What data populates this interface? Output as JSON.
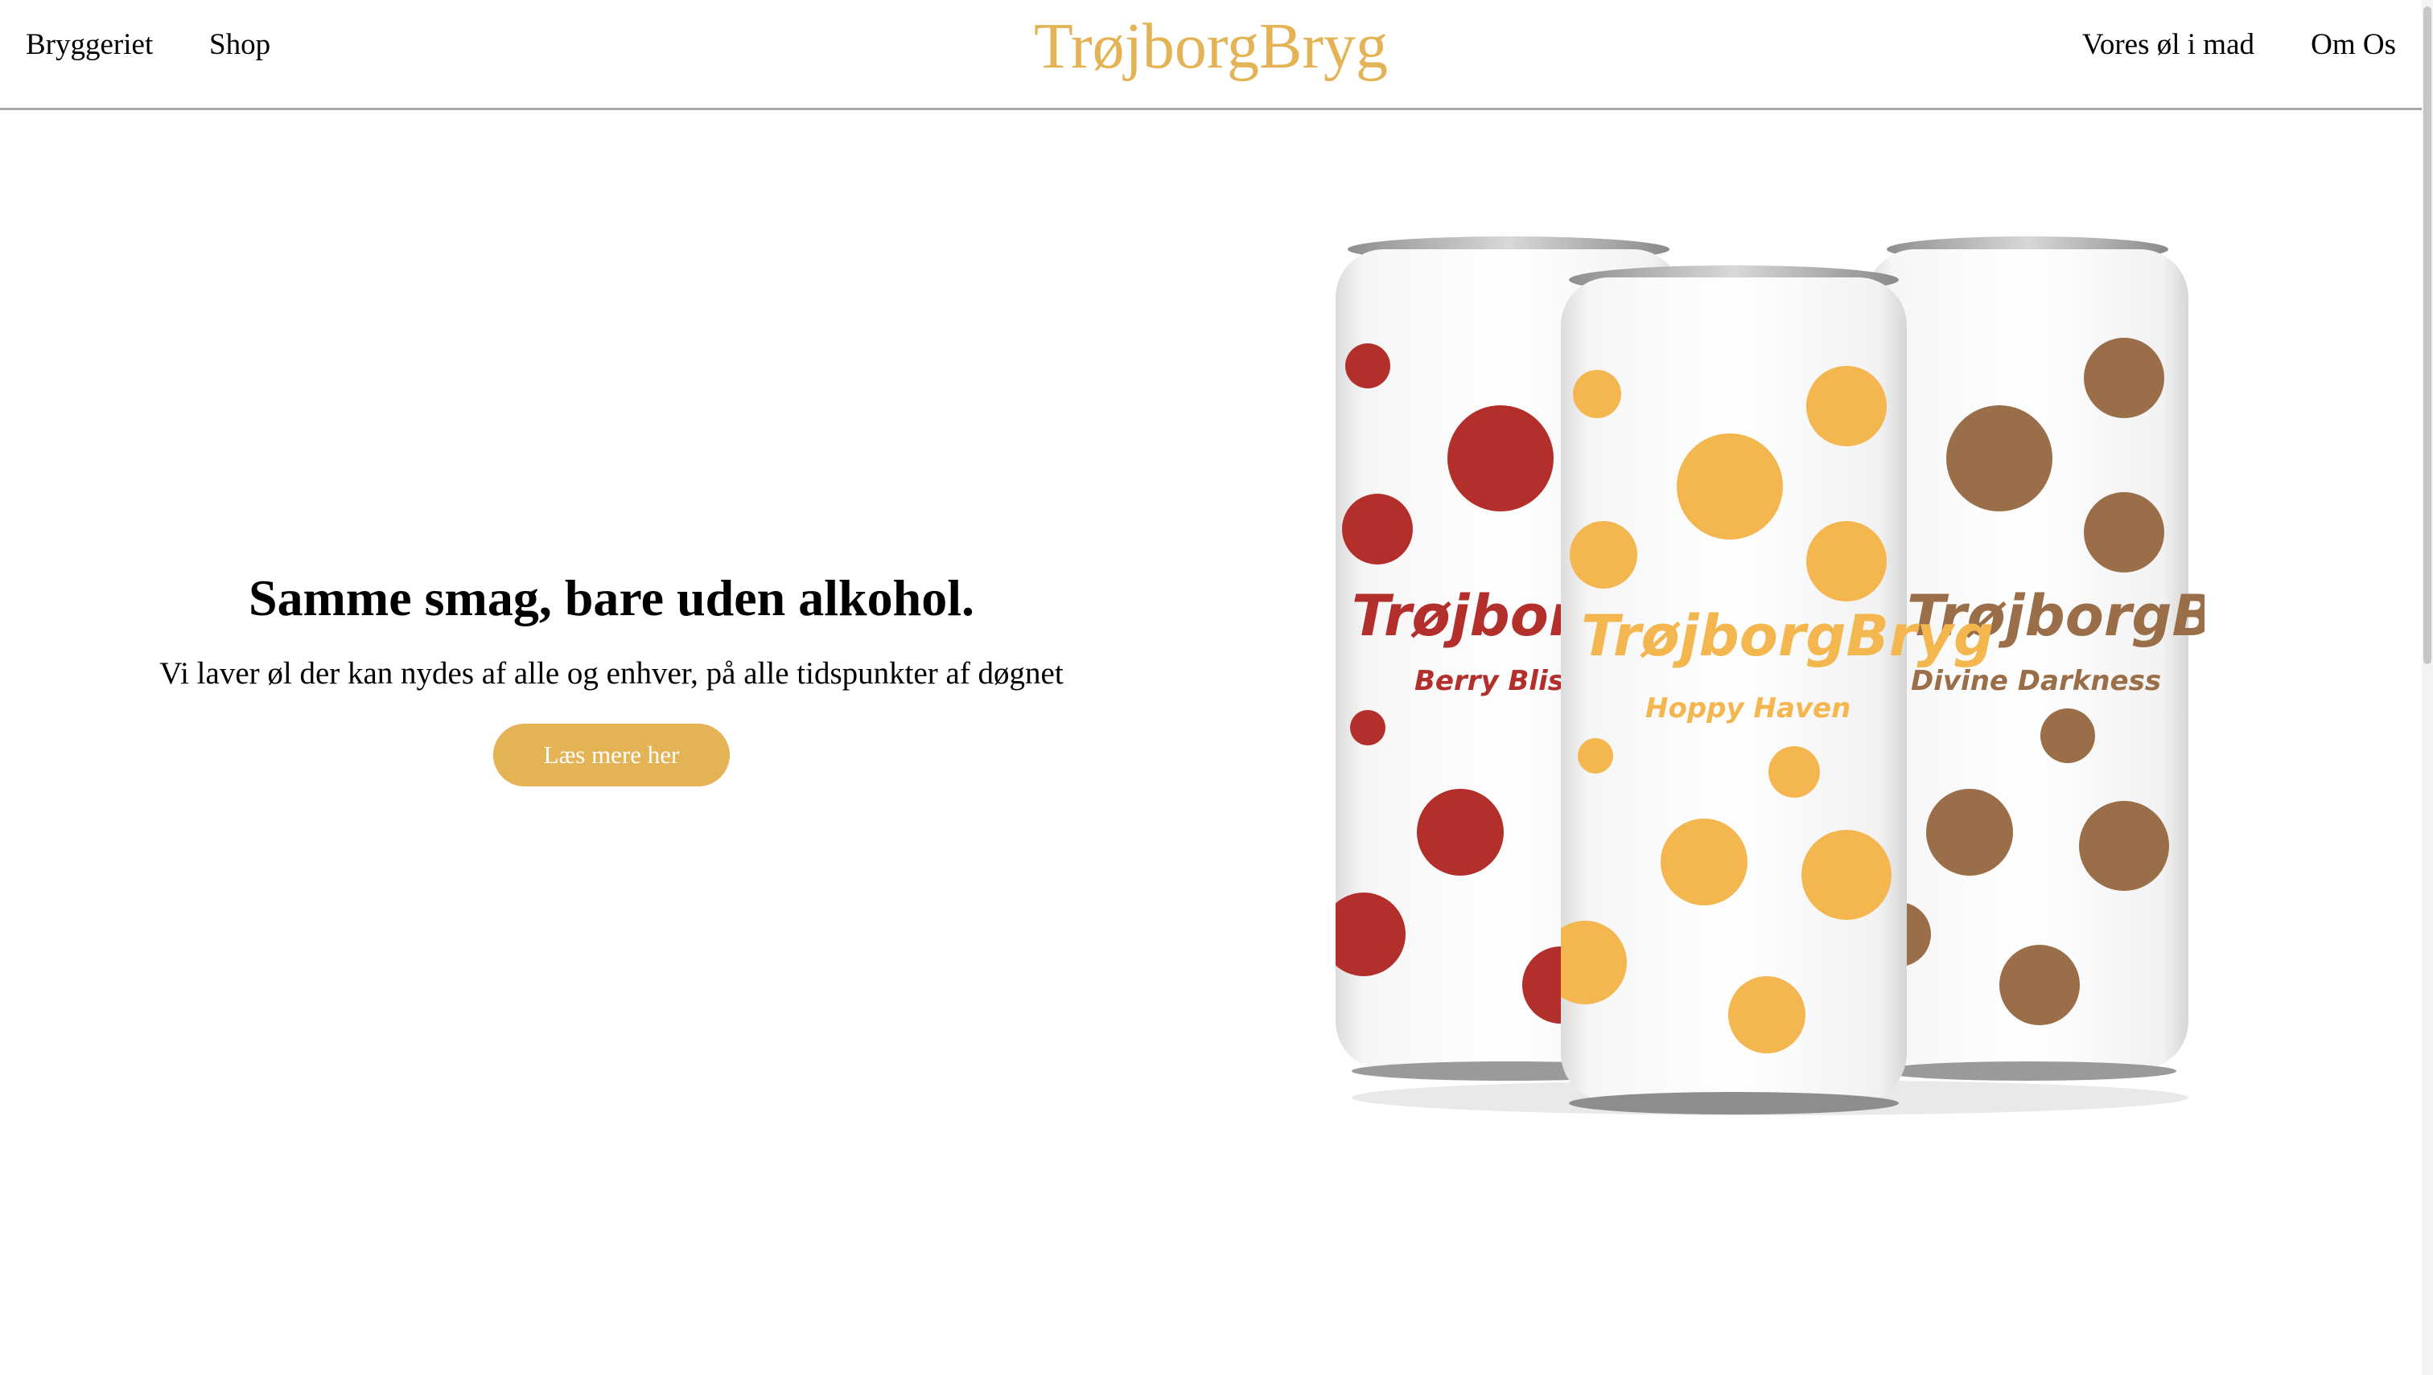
{
  "nav": {
    "left": [
      "Bryggeriet",
      "Shop"
    ],
    "right": [
      "Vores øl i mad",
      "Om Os"
    ],
    "logo": "TrøjborgBryg"
  },
  "hero": {
    "title": "Samme smag, bare uden alkohol.",
    "subtitle": "Vi laver øl der kan nydes af alle og enhver, på alle tidspunkter af døgnet",
    "button_label": "Læs mere her"
  },
  "cans": [
    {
      "brand": "TrøjborgBryg",
      "flavor": "Berry Bliss",
      "color": "#b22f2b"
    },
    {
      "brand": "TrøjborgBryg",
      "flavor": "Hoppy Haven",
      "color": "#f4b64f"
    },
    {
      "brand": "TrøjborgBryg",
      "flavor": "Divine Darkness",
      "color": "#9a6e48"
    }
  ],
  "colors": {
    "accent": "#e3b355",
    "header_border": "#a8a8a8"
  }
}
